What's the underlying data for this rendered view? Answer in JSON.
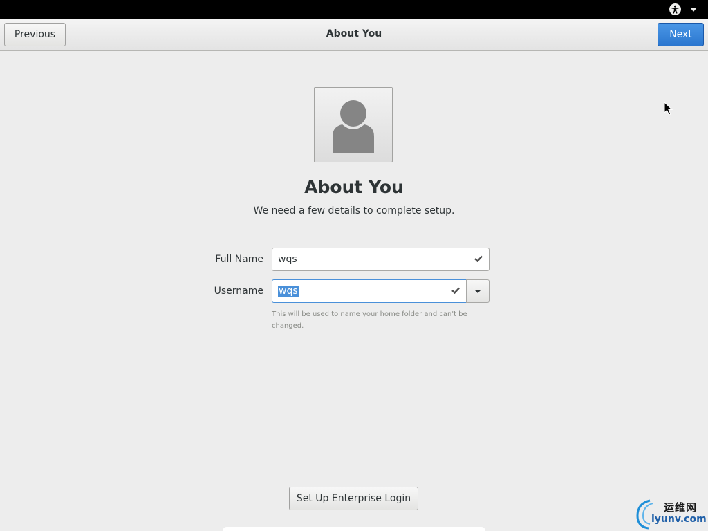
{
  "topbar": {
    "accessibility_icon": "accessibility-icon",
    "menu_icon": "chevron-down-icon"
  },
  "header": {
    "previous_label": "Previous",
    "title": "About You",
    "next_label": "Next"
  },
  "avatar": {
    "icon": "user-avatar-icon"
  },
  "page": {
    "title": "About You",
    "subtitle": "We need a few details to complete setup."
  },
  "form": {
    "full_name": {
      "label": "Full Name",
      "value": "wqs",
      "status_icon": "checkmark-icon"
    },
    "username": {
      "label": "Username",
      "value": "wqs",
      "status_icon": "checkmark-icon",
      "hint": "This will be used to name your home folder and can't be changed."
    }
  },
  "enterprise_login_label": "Set Up Enterprise Login",
  "watermark": {
    "text_cn": "运维网",
    "text_en": "iyunv.com"
  },
  "colors": {
    "accent": "#4a90d9",
    "next_button": "#2b76cf",
    "background": "#ededed"
  }
}
